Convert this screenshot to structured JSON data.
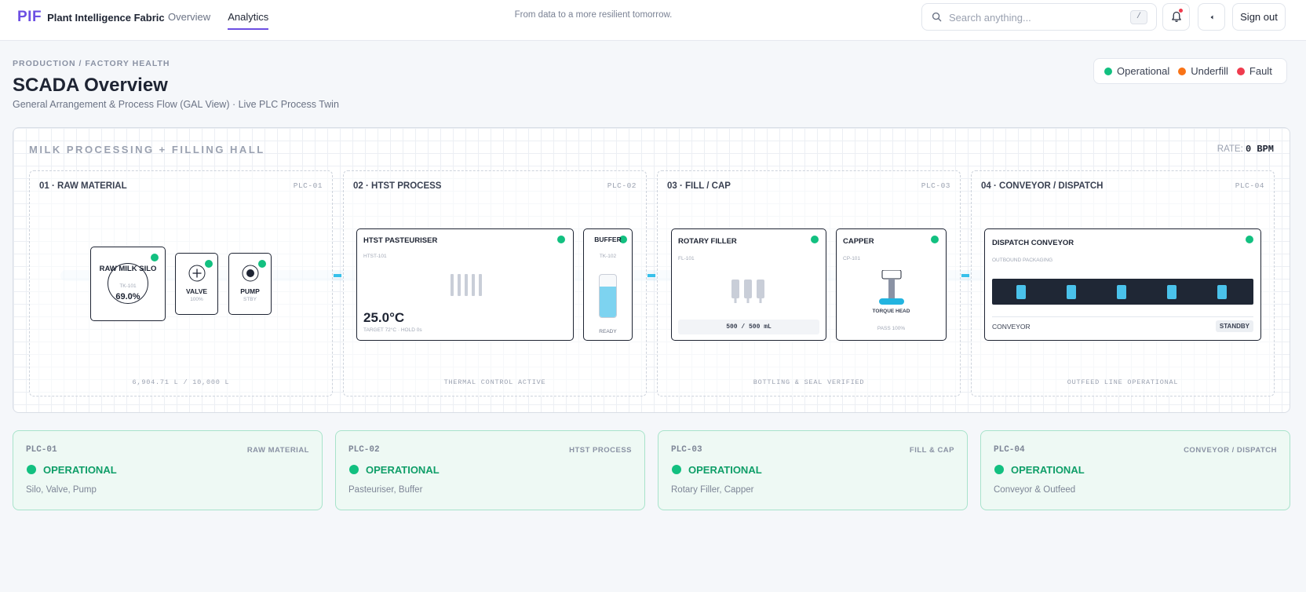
{
  "topbar": {
    "brand_mark": "PIF",
    "brand_name": "Plant Intelligence Fabric",
    "nav": [
      {
        "label": "Overview",
        "active": false
      },
      {
        "label": "Analytics",
        "active": true
      }
    ],
    "tagline": "From data to a more resilient tomorrow.",
    "search": {
      "placeholder": "Search anything...",
      "value": "",
      "shortcut": "/"
    },
    "has_notification": true,
    "signout_label": "Sign out"
  },
  "header": {
    "breadcrumb": "PRODUCTION / FACTORY HEALTH",
    "title": "SCADA Overview",
    "subtitle": "General Arrangement & Process Flow (GAL View) · Live PLC Process Twin"
  },
  "legend": [
    {
      "label": "Operational",
      "color": "#12c080"
    },
    {
      "label": "Underfill",
      "color": "#f97316"
    },
    {
      "label": "Fault",
      "color": "#ef3b4d"
    }
  ],
  "panel": {
    "title": "MILK PROCESSING + FILLING HALL",
    "rate_label": "RATE:",
    "rate_value": "0 BPM",
    "stages": [
      {
        "label": "01 · RAW MATERIAL",
        "plc": "PLC-01",
        "footer": "6,904.71 L / 10,000 L",
        "silo": {
          "title": "RAW MILK SILO",
          "tag": "TK-101",
          "level": "69.0%"
        },
        "valve": {
          "title": "VALVE",
          "value": "100%"
        },
        "pump": {
          "title": "PUMP",
          "value": "STBY"
        }
      },
      {
        "label": "02 · HTST PROCESS",
        "plc": "PLC-02",
        "footer": "THERMAL CONTROL ACTIVE",
        "pasteuriser": {
          "title": "HTST PASTEURISER",
          "tag": "HTST-101",
          "temp": "25.0°C",
          "note": "TARGET 72°C · HOLD 0s"
        },
        "buffer": {
          "title": "BUFFER",
          "tag": "TK-102",
          "status": "READY",
          "level": 0.72
        }
      },
      {
        "label": "03 · FILL / CAP",
        "plc": "PLC-03",
        "footer": "BOTTLING & SEAL VERIFIED",
        "filler": {
          "title": "ROTARY FILLER",
          "tag": "FL-101",
          "volume": "500 / 500 mL"
        },
        "capper": {
          "title": "CAPPER",
          "tag": "CP-101",
          "head": "TORQUE HEAD",
          "pass": "PASS 100%"
        }
      },
      {
        "label": "04 · CONVEYOR / DISPATCH",
        "plc": "PLC-04",
        "footer": "OUTFEED LINE OPERATIONAL",
        "conveyor": {
          "title": "DISPATCH CONVEYOR",
          "subtitle": "OUTBOUND PACKAGING",
          "label": "CONVEYOR",
          "status": "STANDBY"
        }
      }
    ]
  },
  "plc_cards": [
    {
      "id": "PLC-01",
      "area": "RAW MATERIAL",
      "status": "OPERATIONAL",
      "desc": "Silo, Valve, Pump"
    },
    {
      "id": "PLC-02",
      "area": "HTST PROCESS",
      "status": "OPERATIONAL",
      "desc": "Pasteuriser, Buffer"
    },
    {
      "id": "PLC-03",
      "area": "FILL & CAP",
      "status": "OPERATIONAL",
      "desc": "Rotary Filler, Capper"
    },
    {
      "id": "PLC-04",
      "area": "CONVEYOR / DISPATCH",
      "status": "OPERATIONAL",
      "desc": "Conveyor & Outfeed"
    }
  ],
  "icons": {
    "search": "search-icon",
    "bell": "bell-icon",
    "collapse": "chevron-left-icon",
    "valve": "plus-circle-icon",
    "pump": "pump-icon"
  }
}
